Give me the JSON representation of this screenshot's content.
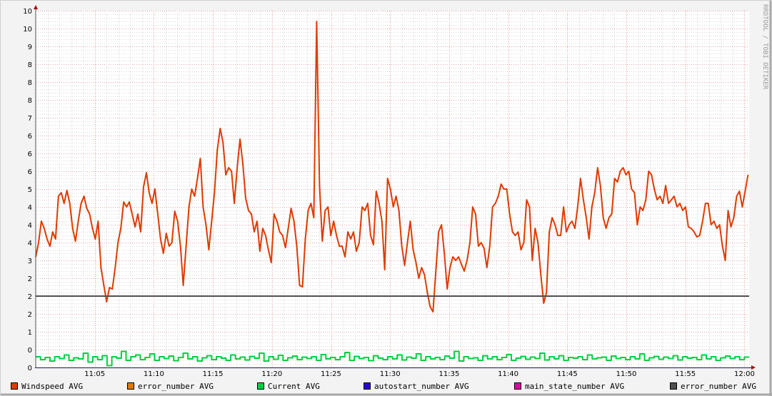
{
  "chart_data": {
    "type": "line",
    "title": "",
    "watermark": "RRDTOOL / TOBI OETIKER",
    "xlim": [
      0,
      60
    ],
    "ylim": [
      0,
      10
    ],
    "grid": true,
    "x_ticks": [
      {
        "t": 5,
        "label": "11:05"
      },
      {
        "t": 10,
        "label": "11:10"
      },
      {
        "t": 15,
        "label": "11:15"
      },
      {
        "t": 20,
        "label": "11:20"
      },
      {
        "t": 25,
        "label": "11:25"
      },
      {
        "t": 30,
        "label": "11:30"
      },
      {
        "t": 35,
        "label": "11:35"
      },
      {
        "t": 40,
        "label": "11:40"
      },
      {
        "t": 45,
        "label": "11:45"
      },
      {
        "t": 50,
        "label": "11:50"
      },
      {
        "t": 55,
        "label": "11:55"
      },
      {
        "t": 60,
        "label": "12:00"
      }
    ],
    "y_tick_labels": [
      "0",
      "0",
      "1",
      "2",
      "2",
      "2",
      "3",
      "4",
      "4",
      "4",
      "5",
      "6",
      "6",
      "6",
      "7",
      "8",
      "8",
      "8",
      "9",
      "10",
      "10"
    ],
    "y_tick_step": 0.5,
    "hrule": {
      "value": 2.0,
      "color": "#505050"
    },
    "legend": [
      {
        "label": "Windspeed AVG",
        "color": "#e03a00"
      },
      {
        "label": "error_number AVG",
        "color": "#e07800"
      },
      {
        "label": "Current AVG",
        "color": "#00d040"
      },
      {
        "label": "autostart_number AVG",
        "color": "#2800e0"
      },
      {
        "label": "main_state_number AVG",
        "color": "#e000a8"
      },
      {
        "label": "error_number AVG",
        "color": "#505050"
      }
    ],
    "series": [
      {
        "name": "Windspeed AVG",
        "color": "#e03a00",
        "x_range": [
          0,
          60.3
        ],
        "values": [
          3.1,
          3.5,
          4.1,
          3.9,
          3.6,
          3.4,
          3.8,
          3.6,
          4.8,
          4.9,
          4.6,
          4.96,
          4.6,
          3.9,
          3.54,
          4.1,
          4.6,
          4.8,
          4.46,
          4.3,
          3.9,
          3.6,
          4.1,
          2.8,
          2.3,
          1.84,
          2.24,
          2.2,
          2.8,
          3.5,
          3.9,
          4.64,
          4.5,
          4.64,
          4.3,
          3.94,
          4.3,
          3.8,
          5.06,
          5.46,
          4.9,
          4.6,
          5.0,
          4.3,
          3.6,
          3.2,
          3.76,
          3.4,
          3.5,
          4.38,
          4.1,
          3.4,
          2.3,
          3.4,
          4.5,
          5.0,
          4.8,
          5.3,
          5.86,
          4.5,
          4.0,
          3.3,
          4.1,
          4.9,
          6.1,
          6.7,
          6.3,
          5.4,
          5.6,
          5.5,
          4.6,
          5.6,
          6.4,
          5.7,
          4.74,
          4.4,
          4.3,
          3.8,
          4.1,
          3.26,
          3.9,
          3.7,
          3.3,
          2.94,
          4.3,
          4.1,
          3.8,
          3.7,
          3.36,
          3.9,
          4.46,
          4.1,
          3.4,
          2.3,
          2.26,
          3.6,
          4.4,
          4.6,
          4.2,
          9.7,
          5.1,
          3.54,
          4.4,
          4.5,
          3.7,
          4.1,
          3.7,
          3.4,
          3.4,
          3.1,
          3.8,
          3.6,
          3.8,
          3.26,
          3.5,
          4.5,
          4.4,
          4.6,
          3.7,
          3.44,
          4.94,
          4.6,
          4.1,
          2.74,
          5.3,
          5.0,
          4.5,
          4.8,
          4.4,
          3.4,
          2.86,
          3.5,
          4.1,
          3.3,
          2.94,
          2.5,
          2.8,
          2.6,
          2.1,
          1.7,
          1.56,
          2.7,
          3.8,
          4.0,
          3.2,
          2.2,
          2.8,
          3.1,
          3.0,
          3.1,
          2.9,
          2.7,
          3.0,
          3.5,
          4.5,
          4.3,
          3.4,
          3.5,
          3.34,
          2.8,
          3.4,
          4.5,
          4.6,
          4.8,
          5.14,
          5.0,
          5.0,
          4.3,
          3.8,
          3.7,
          3.8,
          3.3,
          3.5,
          4.7,
          4.5,
          3.0,
          3.9,
          3.5,
          2.6,
          1.8,
          2.1,
          3.8,
          4.2,
          4.0,
          3.7,
          3.7,
          4.5,
          3.8,
          4.0,
          4.1,
          3.9,
          4.5,
          5.3,
          4.7,
          4.2,
          3.6,
          4.5,
          4.9,
          5.6,
          5.1,
          4.2,
          3.9,
          4.2,
          4.3,
          5.3,
          5.2,
          5.5,
          5.6,
          5.4,
          5.5,
          5.0,
          4.9,
          4.0,
          4.5,
          4.4,
          4.7,
          5.5,
          5.4,
          5.0,
          4.7,
          4.8,
          4.6,
          5.1,
          4.6,
          4.7,
          4.8,
          4.5,
          4.6,
          4.4,
          4.5,
          3.94,
          3.9,
          3.8,
          3.66,
          3.7,
          4.1,
          4.6,
          4.6,
          4.0,
          4.1,
          3.9,
          4.0,
          3.4,
          3.0,
          4.4,
          3.94,
          4.2,
          4.8,
          4.94,
          4.5,
          4.94,
          5.4
        ]
      },
      {
        "name": "Current AVG",
        "color": "#00d040",
        "x_range": [
          0,
          60
        ],
        "values": [
          0.3,
          0.22,
          0.28,
          0.18,
          0.3,
          0.25,
          0.35,
          0.2,
          0.27,
          0.24,
          0.4,
          0.15,
          0.3,
          0.22,
          0.33,
          0.05,
          0.3,
          0.26,
          0.45,
          0.2,
          0.3,
          0.35,
          0.22,
          0.28,
          0.38,
          0.2,
          0.3,
          0.25,
          0.32,
          0.19,
          0.28,
          0.4,
          0.24,
          0.3,
          0.18,
          0.27,
          0.33,
          0.22,
          0.3,
          0.26,
          0.2,
          0.35,
          0.24,
          0.29,
          0.21,
          0.31,
          0.26,
          0.4,
          0.18,
          0.3,
          0.23,
          0.34,
          0.2,
          0.27,
          0.32,
          0.22,
          0.29,
          0.25,
          0.3,
          0.2,
          0.36,
          0.24,
          0.28,
          0.22,
          0.3,
          0.42,
          0.2,
          0.31,
          0.25,
          0.28,
          0.19,
          0.33,
          0.26,
          0.22,
          0.3,
          0.24,
          0.35,
          0.21,
          0.29,
          0.26,
          0.38,
          0.2,
          0.3,
          0.24,
          0.28,
          0.22,
          0.32,
          0.26,
          0.45,
          0.18,
          0.3,
          0.25,
          0.27,
          0.2,
          0.33,
          0.24,
          0.3,
          0.22,
          0.28,
          0.36,
          0.2,
          0.26,
          0.31,
          0.23,
          0.29,
          0.25,
          0.4,
          0.21,
          0.3,
          0.24,
          0.33,
          0.2,
          0.28,
          0.26,
          0.3,
          0.22,
          0.35,
          0.24,
          0.27,
          0.29,
          0.2,
          0.32,
          0.25,
          0.28,
          0.22,
          0.3,
          0.24,
          0.38,
          0.2,
          0.27,
          0.31,
          0.23,
          0.29,
          0.25,
          0.33,
          0.21,
          0.3,
          0.26,
          0.28,
          0.22,
          0.35,
          0.24,
          0.3,
          0.2,
          0.27,
          0.32,
          0.25,
          0.3,
          0.22,
          0.29
        ]
      }
    ]
  }
}
